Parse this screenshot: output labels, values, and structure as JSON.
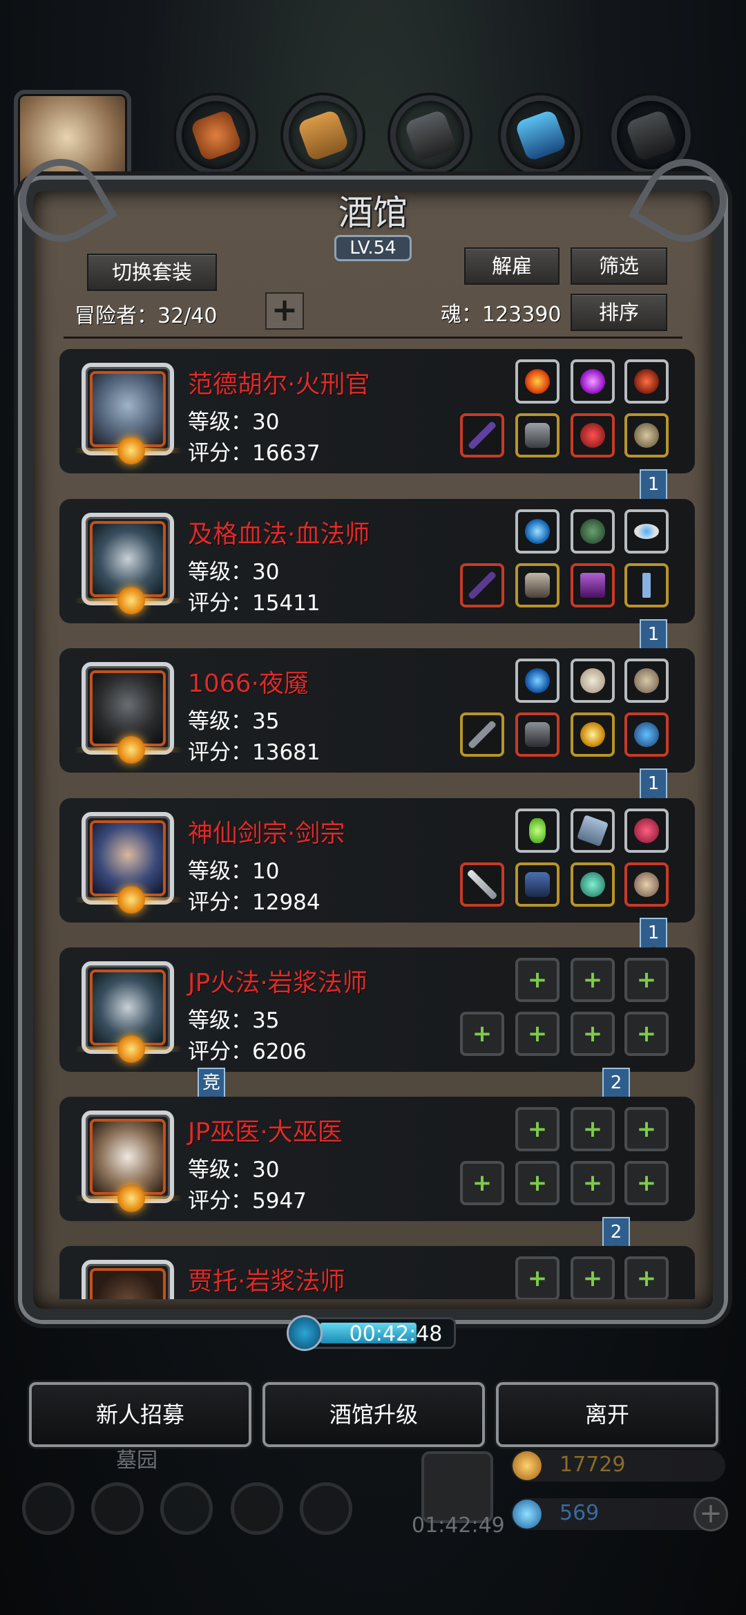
{
  "header": {
    "title": "酒馆",
    "level": "LV.54"
  },
  "controls": {
    "switch_outfit": "切换套装",
    "dismiss": "解雇",
    "filter": "筛选",
    "sort": "排序",
    "adventurers_label": "冒险者：32/40",
    "soul_label": "魂：123390"
  },
  "heroes": [
    {
      "name": "范德胡尔·火刑官",
      "level": "等级：30",
      "score": "评分：16637",
      "tag": "1"
    },
    {
      "name": "及格血法·血法师",
      "level": "等级：30",
      "score": "评分：15411",
      "tag": "1"
    },
    {
      "name": "1066·夜魇",
      "level": "等级：35",
      "score": "评分：13681",
      "tag": "1"
    },
    {
      "name": "神仙剑宗·剑宗",
      "level": "等级：10",
      "score": "评分：12984",
      "tag": "1"
    },
    {
      "name": "JP火法·岩浆法师",
      "level": "等级：35",
      "score": "评分：6206",
      "tag": "2",
      "tag_left": "竞"
    },
    {
      "name": "JP巫医·大巫医",
      "level": "等级：30",
      "score": "评分：5947",
      "tag": "2"
    },
    {
      "name": "贾托·岩浆法师",
      "level": "",
      "score": ""
    }
  ],
  "timer": "00:42:48",
  "footer_buttons": {
    "recruit": "新人招募",
    "upgrade": "酒馆升级",
    "leave": "离开"
  },
  "background": {
    "area_label": "墓园",
    "gift_timer": "01:42:49",
    "gold": "17729",
    "gems": "569"
  }
}
